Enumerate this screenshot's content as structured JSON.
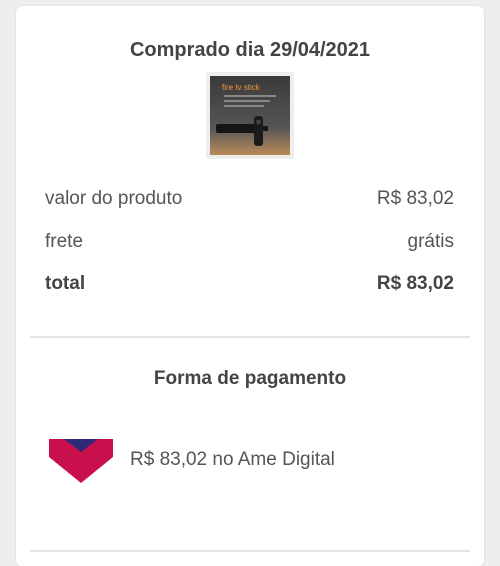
{
  "order": {
    "purchase_date_title": "Comprado dia 29/04/2021",
    "product_thumbnail_icon": "fire-tv-stick-product-image",
    "product_logo_text": "fire tv stick",
    "rows": [
      {
        "label": "valor do produto",
        "value": "R$ 83,02"
      },
      {
        "label": "frete",
        "value": "grátis"
      },
      {
        "label": "total",
        "value": "R$ 83,02"
      }
    ]
  },
  "payment": {
    "title": "Forma de pagamento",
    "method_icon": "ame-digital-logo-icon",
    "method_text": "R$ 83,02 no Ame Digital"
  },
  "colors": {
    "ame_logo_primary": "#c8104c",
    "ame_logo_accent": "#2e2a7a",
    "fire_tv_orange": "#f19634"
  }
}
